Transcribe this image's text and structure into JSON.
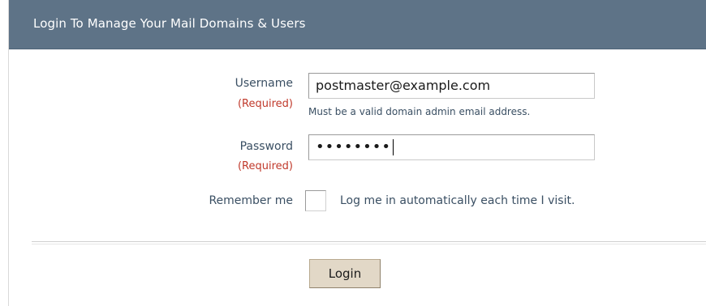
{
  "header": {
    "title": "Login To Manage Your Mail Domains & Users"
  },
  "form": {
    "username": {
      "label": "Username",
      "required": "(Required)",
      "value": "postmaster@example.com",
      "hint": "Must be a valid domain admin email address."
    },
    "password": {
      "label": "Password",
      "required": "(Required)",
      "masked_value": "••••••••"
    },
    "remember": {
      "label": "Remember me",
      "text": "Log me in automatically each time I visit.",
      "checked": false
    },
    "submit_label": "Login"
  },
  "colors": {
    "header_bg": "#5e7387",
    "label_text": "#3a4f63",
    "required_text": "#c0392b",
    "button_bg": "#e2d8c7"
  }
}
